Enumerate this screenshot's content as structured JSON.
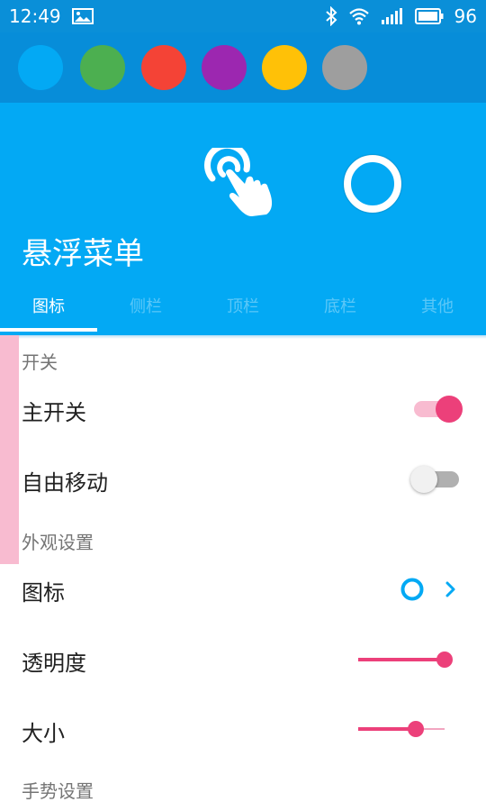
{
  "status_bar": {
    "time": "12:49",
    "battery": "96"
  },
  "palette": {
    "colors": [
      "#03a9f4",
      "#4caf50",
      "#f44336",
      "#9c27b0",
      "#ffc107",
      "#9e9e9e"
    ]
  },
  "header": {
    "title": "悬浮菜单",
    "accent": "#03a9f4"
  },
  "tabs": [
    {
      "label": "图标",
      "active": true
    },
    {
      "label": "侧栏",
      "active": false
    },
    {
      "label": "顶栏",
      "active": false
    },
    {
      "label": "底栏",
      "active": false
    },
    {
      "label": "其他",
      "active": false
    }
  ],
  "sections": {
    "switches": "开关",
    "appearance": "外观设置",
    "gestures": "手势设置"
  },
  "settings": {
    "master_switch": {
      "label": "主开关",
      "on": true
    },
    "free_move": {
      "label": "自由移动",
      "on": false
    },
    "icon": {
      "label": "图标"
    },
    "opacity": {
      "label": "透明度",
      "value_fraction": 1.0
    },
    "size": {
      "label": "大小",
      "value_fraction": 0.66
    }
  },
  "colors": {
    "switch_on": "#ec407a",
    "switch_on_track": "#f8bbd0",
    "switch_off_thumb": "#f1f1f1",
    "switch_off_track": "#b0b0b0"
  }
}
